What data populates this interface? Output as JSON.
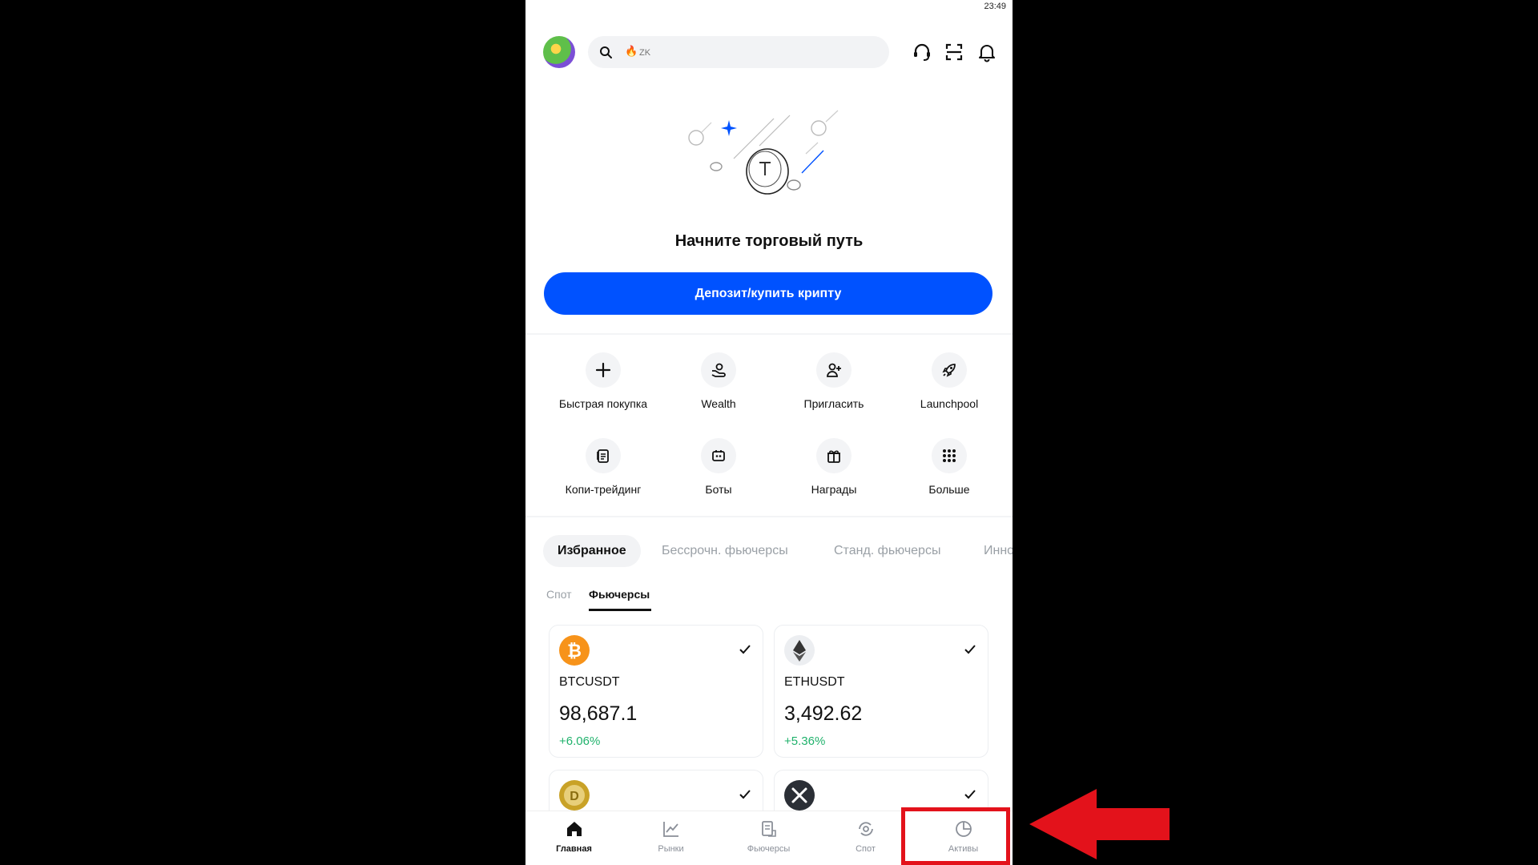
{
  "status": {
    "time": "23:49"
  },
  "header": {
    "search_hint": "ZK",
    "icons": [
      "search-icon",
      "fire-icon",
      "headset-icon",
      "scan-icon",
      "bell-icon"
    ]
  },
  "hero": {
    "title": "Начните торговый путь",
    "cta_label": "Депозит/купить крипту"
  },
  "quick_actions": [
    {
      "label": "Быстрая покупка",
      "icon": "plus-icon"
    },
    {
      "label": "Wealth",
      "icon": "wealth-icon"
    },
    {
      "label": "Пригласить",
      "icon": "invite-icon"
    },
    {
      "label": "Launchpool",
      "icon": "rocket-icon"
    },
    {
      "label": "Копи-трейдинг",
      "icon": "copy-trading-icon"
    },
    {
      "label": "Боты",
      "icon": "bot-icon"
    },
    {
      "label": "Награды",
      "icon": "gift-icon"
    },
    {
      "label": "Больше",
      "icon": "grid-icon"
    }
  ],
  "market_tabs": [
    "Избранное",
    "Бессрочн. фьючерсы",
    "Станд. фьючерсы",
    "Инно"
  ],
  "sub_tabs": {
    "spot": "Спот",
    "futures": "Фьючерсы",
    "active": "futures"
  },
  "cards": [
    {
      "symbol": "BTCUSDT",
      "price": "98,687.1",
      "change": "+6.06%",
      "coin_color": "#f7931a"
    },
    {
      "symbol": "ETHUSDT",
      "price": "3,492.62",
      "change": "+5.36%",
      "coin_color": "#eceef1"
    },
    {
      "symbol": "",
      "price": "",
      "change": "",
      "coin_color": "#c9a227"
    },
    {
      "symbol": "",
      "price": "",
      "change": "",
      "coin_color": "#2b2f36"
    }
  ],
  "bottom_nav": [
    {
      "label": "Главная",
      "icon": "home-icon",
      "active": true
    },
    {
      "label": "Рынки",
      "icon": "markets-icon",
      "active": false
    },
    {
      "label": "Фьючерсы",
      "icon": "futures-icon",
      "active": false
    },
    {
      "label": "Спот",
      "icon": "spot-icon",
      "active": false
    },
    {
      "label": "Активы",
      "icon": "assets-pie-icon",
      "active": false
    }
  ],
  "colors": {
    "accent": "#0052ff",
    "positive": "#20b26c",
    "annotation": "#e3121b"
  }
}
